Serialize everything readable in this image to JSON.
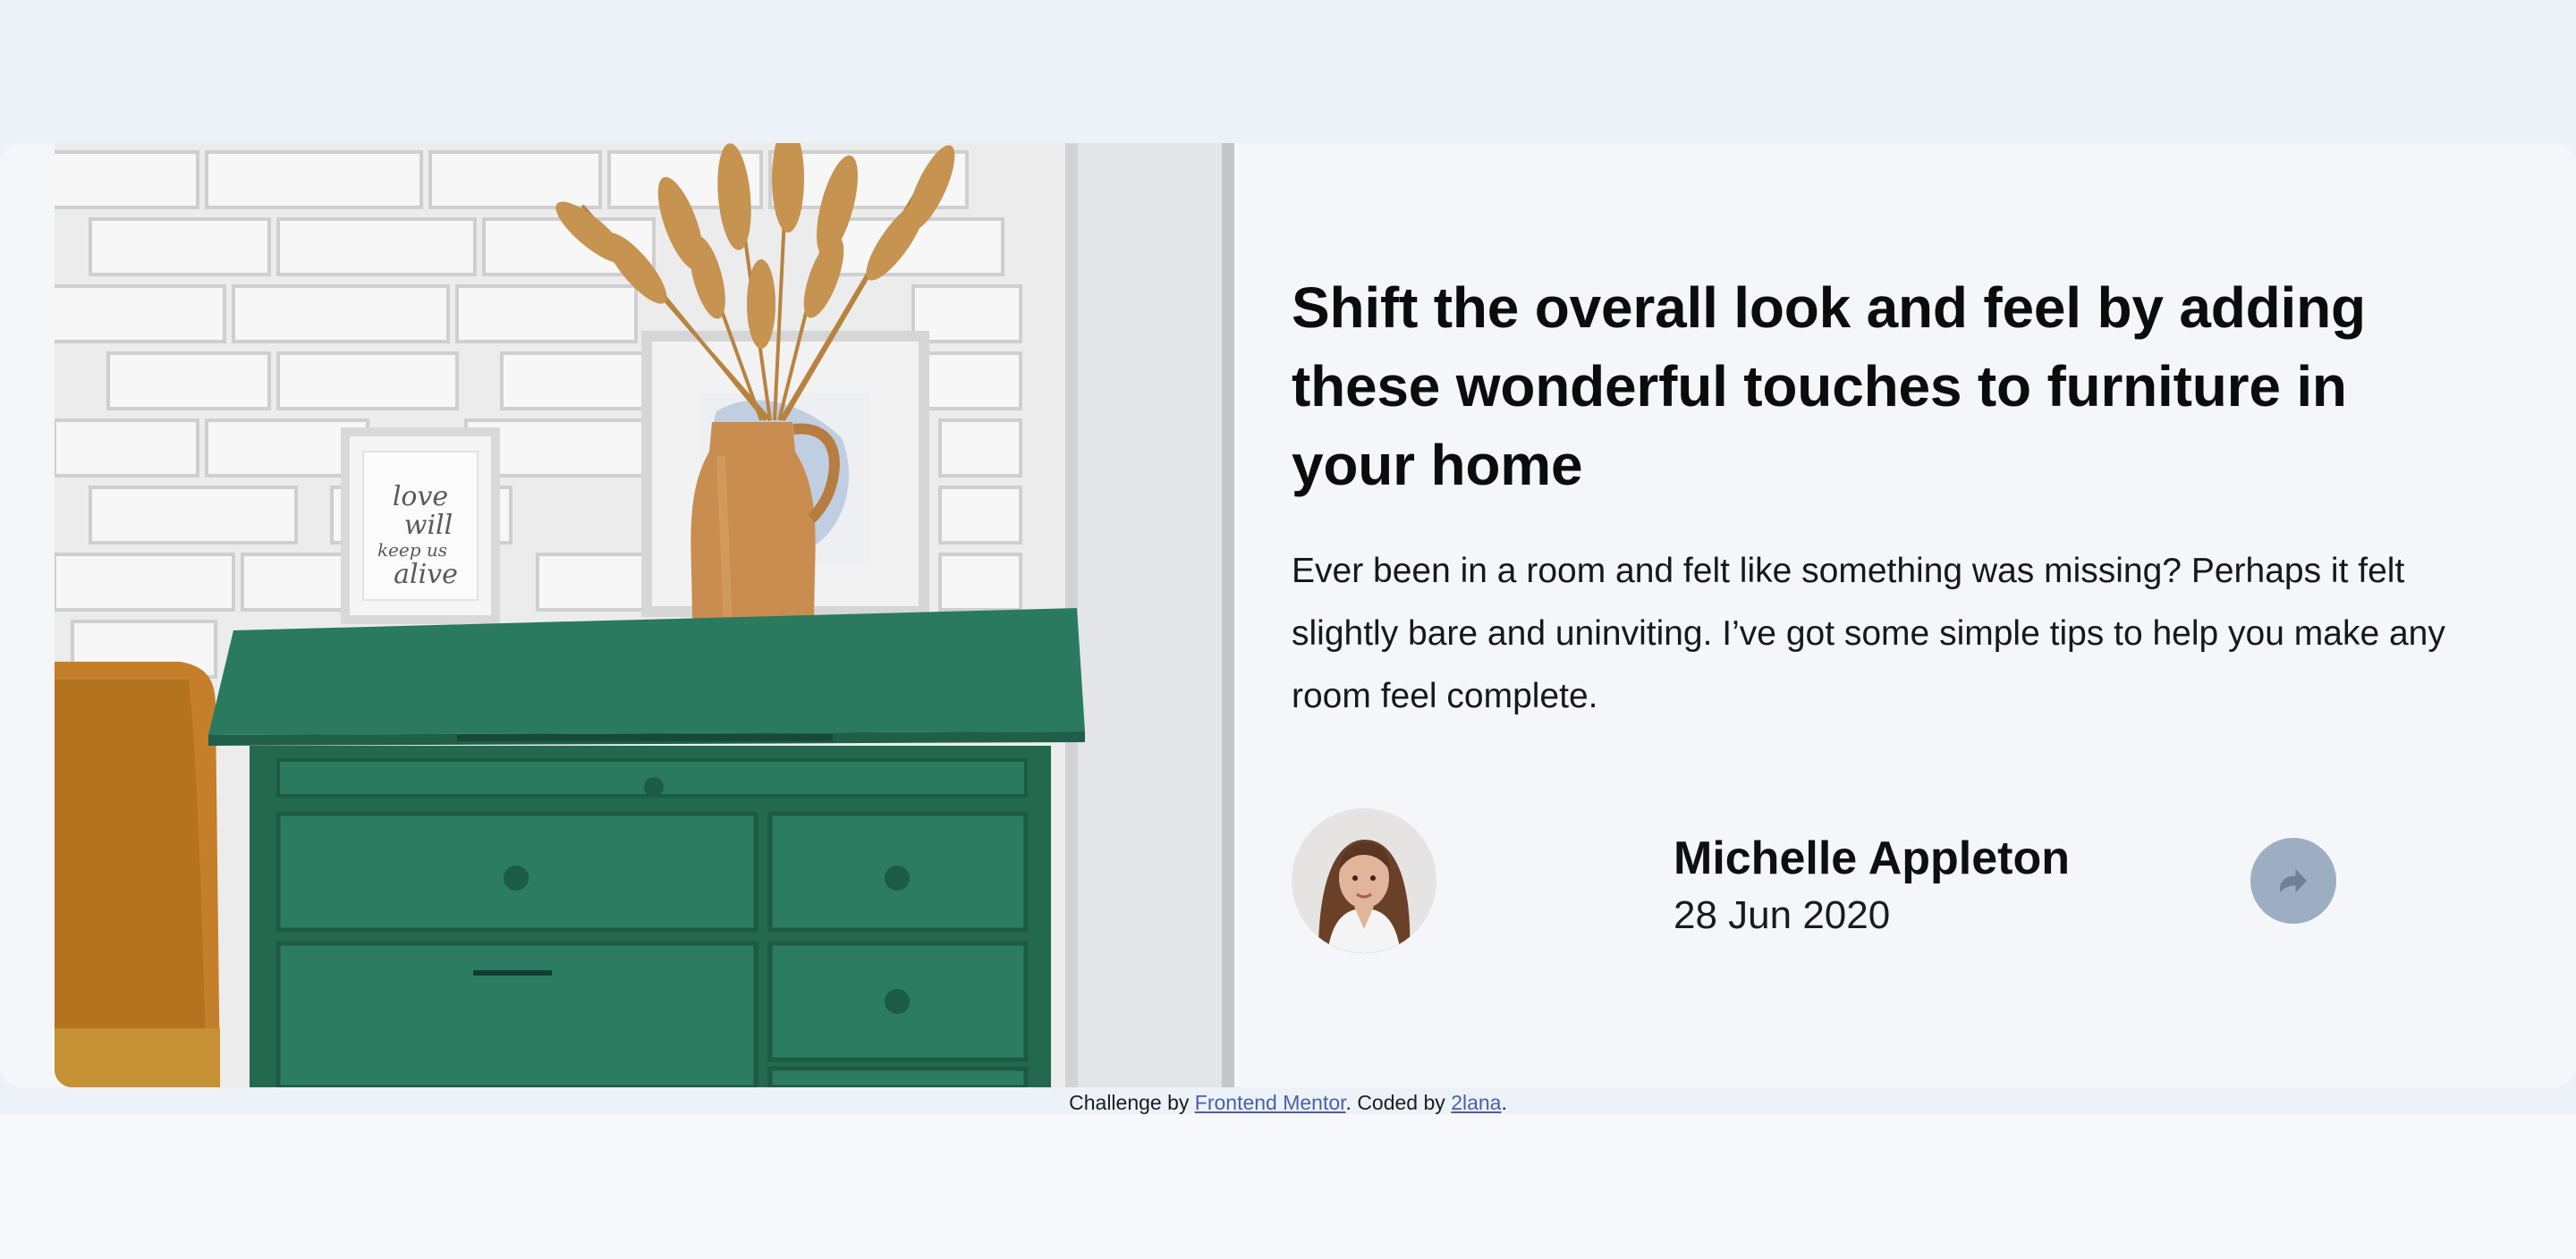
{
  "article": {
    "headline": "Shift the overall look and feel by adding these wonderful touches to furniture in your home",
    "excerpt": "Ever been in a room and felt like something was missing? Perhaps it felt slightly bare and uninviting. I’ve got some simple tips to help you make any room feel complete."
  },
  "author": {
    "name": "Michelle Appleton",
    "date": "28 Jun 2020"
  },
  "share": {
    "icon": "share-arrow-icon"
  },
  "attribution": {
    "prefix": "Challenge by ",
    "link1": "Frontend Mentor",
    "middle": ". Coded by ",
    "link2": "2lana",
    "suffix": "."
  },
  "colors": {
    "page_background": "#ecf2f8",
    "card_background": "#f4f6fa",
    "share_button": "#9daec3",
    "dresser_green": "#2a7a5f",
    "vase": "#c98d4f",
    "link": "#4b5fa8"
  }
}
